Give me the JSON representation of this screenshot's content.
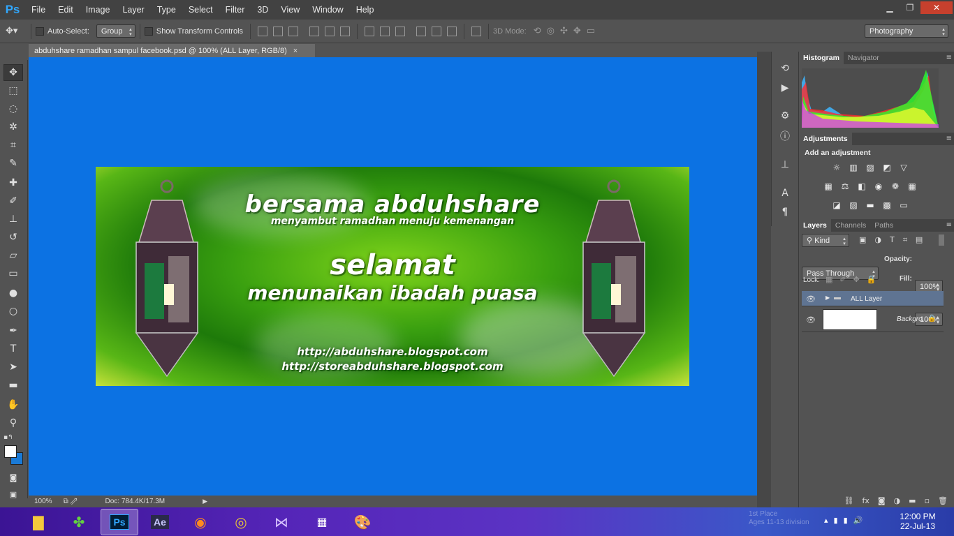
{
  "app": {
    "logo": "Ps",
    "menus": [
      "File",
      "Edit",
      "Image",
      "Layer",
      "Type",
      "Select",
      "Filter",
      "3D",
      "View",
      "Window",
      "Help"
    ],
    "window_controls": {
      "minimize": "▁",
      "restore": "❐",
      "close": "✕"
    }
  },
  "options": {
    "auto_select_label": "Auto-Select:",
    "auto_select_value": "Group",
    "show_transform_label": "Show Transform Controls",
    "mode_3d_label": "3D Mode:",
    "workspace": "Photography"
  },
  "document": {
    "tab_title": "abduhshare ramadhan sampul facebook.psd @ 100% (ALL Layer, RGB/8)",
    "tab_close": "×"
  },
  "banner": {
    "line1": "bersama abduhshare",
    "line2": "menyambut ramadhan menuju kemenangan",
    "line3": "selamat",
    "line4": "menunaikan ibadah puasa",
    "url1": "http://abduhshare.blogspot.com",
    "url2": "http://storeabduhshare.blogspot.com"
  },
  "status": {
    "zoom": "100%",
    "doc_info": "Doc: 784.4K/17.3M"
  },
  "panels": {
    "histogram_tabs": [
      "Histogram",
      "Navigator"
    ],
    "adjustments_tab": "Adjustments",
    "add_adjustment": "Add an adjustment",
    "layers_tabs": [
      "Layers",
      "Channels",
      "Paths"
    ],
    "kind_filter": "Kind",
    "blend_mode": "Pass Through",
    "opacity_label": "Opacity:",
    "opacity_value": "100%",
    "lock_label": "Lock:",
    "fill_label": "Fill:",
    "fill_value": "100%",
    "layers": [
      {
        "name": "ALL Layer",
        "type": "group"
      },
      {
        "name": "Backgro...",
        "type": "background"
      }
    ]
  },
  "taskbar": {
    "time": "12:00 PM",
    "date": "22-Jul-13",
    "ghost_text_1": "1st Place",
    "ghost_text_2": "Ages 11-13 division"
  },
  "colors": {
    "canvas_bg": "#0c72e3",
    "panel_bg": "#535353",
    "menubar_bg": "#424242",
    "ps_blue": "#31a8ff"
  }
}
